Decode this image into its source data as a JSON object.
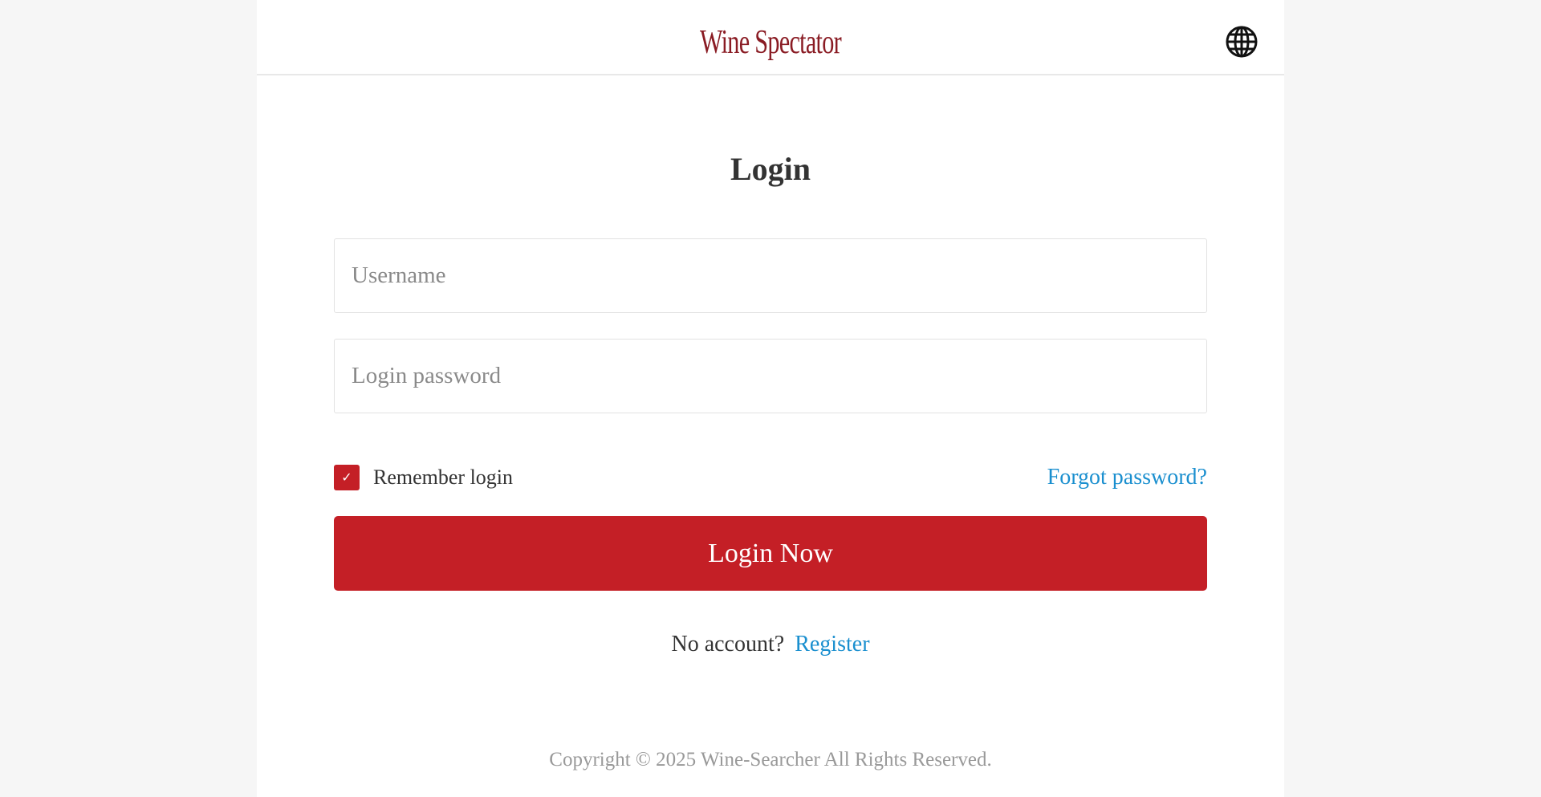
{
  "header": {
    "logo_text": "Wine Spectator",
    "language_icon": "globe-icon"
  },
  "login": {
    "title": "Login",
    "username_placeholder": "Username",
    "username_value": "",
    "password_placeholder": "Login password",
    "password_value": "",
    "remember_label": "Remember login",
    "remember_checked": true,
    "checkbox_icon": "check-icon",
    "forgot_label": "Forgot password?",
    "submit_label": "Login Now",
    "no_account_text": "No account?",
    "register_label": "Register"
  },
  "footer": {
    "copyright": "Copyright © 2025 Wine-Searcher All Rights Reserved."
  },
  "colors": {
    "brand": "#8a1c24",
    "accent": "#c41f26",
    "link": "#1a8fcf",
    "page_background": "#f6f6f6"
  }
}
